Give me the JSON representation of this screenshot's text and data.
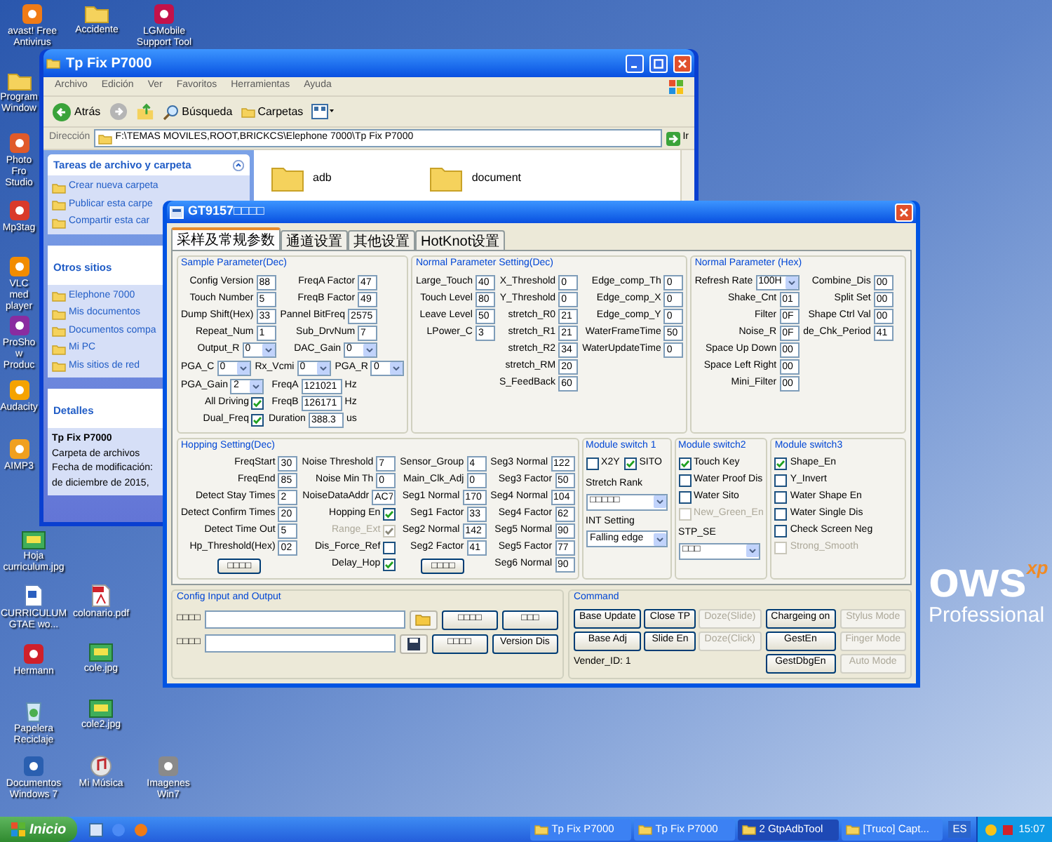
{
  "desktop_icons": [
    {
      "label": "avast! Free Antivirus",
      "kind": "app",
      "color": "#f07b16"
    },
    {
      "label": "Accidente",
      "kind": "folder"
    },
    {
      "label": "LGMobile Support Tool",
      "kind": "app",
      "color": "#c3124a"
    },
    {
      "label": "Program Window",
      "kind": "folder"
    },
    {
      "label": "Photo Fro Studio",
      "kind": "app",
      "color": "#e05a2a"
    },
    {
      "label": "Mp3tag",
      "kind": "app",
      "color": "#d93a2b"
    },
    {
      "label": "VLC med player",
      "kind": "app",
      "color": "#f28c00"
    },
    {
      "label": "ProShow Produc",
      "kind": "app",
      "color": "#8a2ca0"
    },
    {
      "label": "Audacity",
      "kind": "app",
      "color": "#f5a300"
    },
    {
      "label": "AIMP3",
      "kind": "app",
      "color": "#f0a020"
    },
    {
      "label": "Hoja curriculum.jpg",
      "kind": "image"
    },
    {
      "label": "CURRICULUM GTAE wo...",
      "kind": "doc"
    },
    {
      "label": "colonario.pdf",
      "kind": "pdf"
    },
    {
      "label": "Hermann",
      "kind": "app",
      "color": "#d0202a"
    },
    {
      "label": "cole.jpg",
      "kind": "image"
    },
    {
      "label": "Papelera Reciclaje",
      "kind": "trash"
    },
    {
      "label": "cole2.jpg",
      "kind": "image"
    },
    {
      "label": "Documentos Windows 7",
      "kind": "app",
      "color": "#2a5fb0"
    },
    {
      "label": "Mi Música",
      "kind": "music"
    },
    {
      "label": "Imagenes Win7",
      "kind": "app",
      "color": "#8a8a8a"
    }
  ],
  "wallpaper_logo": {
    "word": "ows",
    "mark": "xp",
    "edition": "Professional"
  },
  "explorer": {
    "title": "Tp Fix P7000",
    "menu": [
      "Archivo",
      "Edición",
      "Ver",
      "Favoritos",
      "Herramientas",
      "Ayuda"
    ],
    "toolbar": {
      "back": "Atrás",
      "search": "Búsqueda",
      "folders": "Carpetas"
    },
    "address": {
      "label": "Dirección",
      "value": "F:\\TEMAS MOVILES,ROOT,BRICKCS\\Elephone 7000\\Tp Fix P7000",
      "go": "Ir"
    },
    "tasks": {
      "title": "Tareas de archivo y carpeta",
      "items": [
        "Crear nueva carpeta",
        "Publicar esta carpe",
        "Compartir esta car"
      ]
    },
    "places": {
      "title": "Otros sitios",
      "items": [
        "Elephone 7000",
        "Mis documentos",
        "Documentos compa",
        "Mi PC",
        "Mis sitios de red"
      ]
    },
    "details": {
      "title": "Detalles",
      "name": "Tp Fix P7000",
      "type": "Carpeta de archivos",
      "lines": [
        "Fecha de modificación:",
        "de diciembre de 2015,"
      ]
    },
    "files": [
      {
        "name": "adb"
      },
      {
        "name": "document"
      }
    ]
  },
  "dialog": {
    "title": "GT9157□□□□",
    "tabs": [
      {
        "label": "采样及常规参数",
        "selected": true
      },
      {
        "label": "通道设置",
        "selected": false
      },
      {
        "label": "其他设置",
        "selected": false
      },
      {
        "label": "HotKnot设置",
        "selected": false
      }
    ],
    "top_groups": [
      {
        "title": "Sample Parameter(Dec)",
        "sections": [
          {
            "columns": [
              [
                {
                  "kind": "field",
                  "label": "Config Version",
                  "value": "88"
                },
                {
                  "kind": "field",
                  "label": "Touch Number",
                  "value": "5"
                },
                {
                  "kind": "field",
                  "label": "Dump Shift(Hex)",
                  "value": "33"
                },
                {
                  "kind": "field",
                  "label": "Repeat_Num",
                  "value": "1"
                },
                {
                  "kind": "select",
                  "label": "Output_R",
                  "value": "0"
                }
              ],
              [
                {
                  "kind": "field",
                  "label": "FreqA Factor",
                  "value": "47"
                },
                {
                  "kind": "field",
                  "label": "FreqB Factor",
                  "value": "49"
                },
                {
                  "kind": "field",
                  "label": "Pannel BitFreq",
                  "value": "2575"
                },
                {
                  "kind": "field",
                  "label": "Sub_DrvNum",
                  "value": "7"
                },
                {
                  "kind": "select",
                  "label": "DAC_Gain",
                  "value": "0"
                }
              ]
            ]
          },
          {
            "columns": [
              [
                {
                  "kind": "select",
                  "label": "PGA_C",
                  "value": "0"
                }
              ],
              [
                {
                  "kind": "select",
                  "label": "Rx_Vcmi",
                  "value": "0"
                }
              ],
              [
                {
                  "kind": "select",
                  "label": "PGA_R",
                  "value": "0"
                }
              ]
            ]
          },
          {
            "columns": [
              [
                {
                  "kind": "select",
                  "label": "PGA_Gain",
                  "value": "2"
                },
                {
                  "kind": "check_after",
                  "label": "All Driving",
                  "checked": true,
                  "disabled": false
                },
                {
                  "kind": "check_after",
                  "label": "Dual_Freq",
                  "checked": true,
                  "disabled": false
                }
              ],
              [
                {
                  "kind": "field",
                  "label": "FreqA",
                  "value": "121021",
                  "unit": "Hz"
                },
                {
                  "kind": "field",
                  "label": "FreqB",
                  "value": "126171",
                  "unit": "Hz"
                },
                {
                  "kind": "field",
                  "label": "Duration",
                  "value": "388.3",
                  "unit": "us"
                }
              ]
            ]
          }
        ]
      },
      {
        "title": "Normal Parameter Setting(Dec)",
        "sections": [
          {
            "columns": [
              [
                {
                  "kind": "field",
                  "label": "Large_Touch",
                  "value": "40"
                },
                {
                  "kind": "field",
                  "label": "Touch Level",
                  "value": "80"
                },
                {
                  "kind": "field",
                  "label": "Leave Level",
                  "value": "50"
                },
                {
                  "kind": "field",
                  "label": "LPower_C",
                  "value": "3"
                }
              ],
              [
                {
                  "kind": "field",
                  "label": "X_Threshold",
                  "value": "0"
                },
                {
                  "kind": "field",
                  "label": "Y_Threshold",
                  "value": "0"
                },
                {
                  "kind": "field",
                  "label": "stretch_R0",
                  "value": "21"
                },
                {
                  "kind": "field",
                  "label": "stretch_R1",
                  "value": "21"
                },
                {
                  "kind": "field",
                  "label": "stretch_R2",
                  "value": "34"
                },
                {
                  "kind": "field",
                  "label": "stretch_RM",
                  "value": "20"
                },
                {
                  "kind": "field",
                  "label": "S_FeedBack",
                  "value": "60"
                }
              ],
              [
                {
                  "kind": "field",
                  "label": "Edge_comp_Th",
                  "value": "0"
                },
                {
                  "kind": "field",
                  "label": "Edge_comp_X",
                  "value": "0"
                },
                {
                  "kind": "field",
                  "label": "Edge_comp_Y",
                  "value": "0"
                },
                {
                  "kind": "field",
                  "label": "WaterFrameTime",
                  "value": "50"
                },
                {
                  "kind": "field",
                  "label": "WaterUpdateTime",
                  "value": "0"
                }
              ]
            ]
          }
        ]
      },
      {
        "title": "Normal Parameter (Hex)",
        "sections": [
          {
            "columns": [
              [
                {
                  "kind": "select",
                  "label": "Refresh Rate",
                  "value": "100H"
                },
                {
                  "kind": "field",
                  "label": "Shake_Cnt",
                  "value": "01"
                },
                {
                  "kind": "field",
                  "label": "Filter",
                  "value": "0F"
                },
                {
                  "kind": "field",
                  "label": "Noise_R",
                  "value": "0F"
                },
                {
                  "kind": "field",
                  "label": "Space Up Down",
                  "value": "00"
                },
                {
                  "kind": "field",
                  "label": "Space Left Right",
                  "value": "00"
                },
                {
                  "kind": "field",
                  "label": "Mini_Filter",
                  "value": "00"
                }
              ],
              [
                {
                  "kind": "field",
                  "label": "Combine_Dis",
                  "value": "00"
                },
                {
                  "kind": "field",
                  "label": "Split Set",
                  "value": "00"
                },
                {
                  "kind": "field",
                  "label": "Shape Ctrl Val",
                  "value": "00"
                },
                {
                  "kind": "field",
                  "label": "de_Chk_Period",
                  "value": "41"
                }
              ]
            ]
          }
        ]
      }
    ],
    "middle_groups": [
      {
        "title": "Hopping Setting(Dec)",
        "sections": [
          {
            "columns": [
              [
                {
                  "kind": "field",
                  "label": "FreqStart",
                  "value": "30"
                },
                {
                  "kind": "field",
                  "label": "FreqEnd",
                  "value": "85"
                },
                {
                  "kind": "field",
                  "label": "Detect Stay Times",
                  "value": "2"
                },
                {
                  "kind": "field",
                  "label": "Detect Confirm Times",
                  "value": "20"
                },
                {
                  "kind": "field",
                  "label": "Detect Time Out",
                  "value": "5"
                },
                {
                  "kind": "field",
                  "label": "Hp_Threshold(Hex)",
                  "value": "02"
                },
                {
                  "kind": "button",
                  "label": "□□□□"
                }
              ],
              [
                {
                  "kind": "field",
                  "label": "Noise Threshold",
                  "value": "7"
                },
                {
                  "kind": "field",
                  "label": "Noise Min Th",
                  "value": "0"
                },
                {
                  "kind": "field",
                  "label": "NoiseDataAddr",
                  "value": "AC7"
                },
                {
                  "kind": "check_after",
                  "label": "Hopping En",
                  "checked": true,
                  "disabled": false
                },
                {
                  "kind": "check_after",
                  "label": "Range_Ext",
                  "checked": true,
                  "disabled": true
                },
                {
                  "kind": "check_after",
                  "label": "Dis_Force_Ref",
                  "checked": false,
                  "disabled": false
                },
                {
                  "kind": "check_after",
                  "label": "Delay_Hop",
                  "checked": true,
                  "disabled": false
                }
              ],
              [
                {
                  "kind": "field",
                  "label": "Sensor_Group",
                  "value": "4"
                },
                {
                  "kind": "field",
                  "label": "Main_Clk_Adj",
                  "value": "0"
                },
                {
                  "kind": "field",
                  "label": "Seg1 Normal",
                  "value": "170"
                },
                {
                  "kind": "field",
                  "label": "Seg1 Factor",
                  "value": "33"
                },
                {
                  "kind": "field",
                  "label": "Seg2 Normal",
                  "value": "142"
                },
                {
                  "kind": "field",
                  "label": "Seg2 Factor",
                  "value": "41"
                },
                {
                  "kind": "button",
                  "label": "□□□□"
                }
              ],
              [
                {
                  "kind": "field",
                  "label": "Seg3 Normal",
                  "value": "122"
                },
                {
                  "kind": "field",
                  "label": "Seg3 Factor",
                  "value": "50"
                },
                {
                  "kind": "field",
                  "label": "Seg4 Normal",
                  "value": "104"
                },
                {
                  "kind": "field",
                  "label": "Seg4 Factor",
                  "value": "62"
                },
                {
                  "kind": "field",
                  "label": "Seg5 Normal",
                  "value": "90"
                },
                {
                  "kind": "field",
                  "label": "Seg5 Factor",
                  "value": "77"
                },
                {
                  "kind": "field",
                  "label": "Seg6 Normal",
                  "value": "90"
                }
              ]
            ]
          }
        ]
      },
      {
        "title": "Module switch 1",
        "sections": [
          {
            "columns": [
              [
                {
                  "kind": "check_before",
                  "label": "X2Y",
                  "checked": false,
                  "disabled": false
                }
              ],
              [
                {
                  "kind": "check_before",
                  "label": "SITO",
                  "checked": true,
                  "disabled": false
                }
              ]
            ]
          },
          {
            "columns": [
              [
                {
                  "kind": "dropdown",
                  "label": "Stretch Rank",
                  "value": "□□□□□"
                },
                {
                  "kind": "dropdown",
                  "label": "INT Setting",
                  "value": "Falling edge"
                }
              ]
            ]
          }
        ]
      },
      {
        "title": "Module switch2",
        "sections": [
          {
            "columns": [
              [
                {
                  "kind": "check_before",
                  "label": "Touch Key",
                  "checked": true,
                  "disabled": false
                },
                {
                  "kind": "check_before",
                  "label": "Water Proof Dis",
                  "checked": false,
                  "disabled": false
                },
                {
                  "kind": "check_before",
                  "label": "Water Sito",
                  "checked": false,
                  "disabled": false
                },
                {
                  "kind": "check_before",
                  "label": "New_Green_En",
                  "checked": false,
                  "disabled": true
                },
                {
                  "kind": "dropdown",
                  "label": "STP_SE",
                  "value": "□□□"
                }
              ]
            ]
          }
        ]
      },
      {
        "title": "Module switch3",
        "sections": [
          {
            "columns": [
              [
                {
                  "kind": "check_before",
                  "label": "Shape_En",
                  "checked": true,
                  "disabled": false
                },
                {
                  "kind": "check_before",
                  "label": "Y_Invert",
                  "checked": false,
                  "disabled": false
                },
                {
                  "kind": "check_before",
                  "label": "Water Shape En",
                  "checked": false,
                  "disabled": false
                },
                {
                  "kind": "check_before",
                  "label": "Water Single Dis",
                  "checked": false,
                  "disabled": false
                },
                {
                  "kind": "check_before",
                  "label": "Check Screen Neg",
                  "checked": false,
                  "disabled": false
                },
                {
                  "kind": "check_before",
                  "label": "Strong_Smooth",
                  "checked": false,
                  "disabled": true
                }
              ]
            ]
          }
        ]
      }
    ],
    "config": {
      "title": "Config Input and Output",
      "rows": [
        {
          "label": "□□□□",
          "kind": "folder",
          "buttons": [
            "□□□□",
            "□□□"
          ]
        },
        {
          "label": "□□□□",
          "kind": "disk",
          "buttons": [
            "□□□□",
            "Version Dis"
          ]
        }
      ]
    },
    "command": {
      "title": "Command",
      "columns": [
        [
          {
            "label": "Base Update",
            "disabled": false
          },
          {
            "label": "Base Adj",
            "disabled": false
          }
        ],
        [
          {
            "label": "Close TP",
            "disabled": false
          },
          {
            "label": "Slide En",
            "disabled": false
          }
        ],
        [
          {
            "label": "Doze(Slide)",
            "disabled": true
          },
          {
            "label": "Doze(Click)",
            "disabled": true
          }
        ],
        [
          {
            "label": "Chargeing on",
            "disabled": false
          },
          {
            "label": "GestEn",
            "disabled": false
          },
          {
            "label": "GestDbgEn",
            "disabled": false
          }
        ],
        [
          {
            "label": "Stylus Mode",
            "disabled": true
          },
          {
            "label": "Finger Mode",
            "disabled": true
          },
          {
            "label": "Auto Mode",
            "disabled": true
          }
        ]
      ],
      "vendor": "Vender_ID: 1"
    }
  },
  "taskbar": {
    "start": "Inicio",
    "tasks": [
      {
        "label": "Tp Fix P7000",
        "selected": false
      },
      {
        "label": "Tp Fix P7000",
        "selected": false
      },
      {
        "label": "2 GtpAdbTool",
        "selected": true
      },
      {
        "label": "[Truco] Capt...",
        "selected": false
      }
    ],
    "language": "ES",
    "clock": "15:07"
  }
}
